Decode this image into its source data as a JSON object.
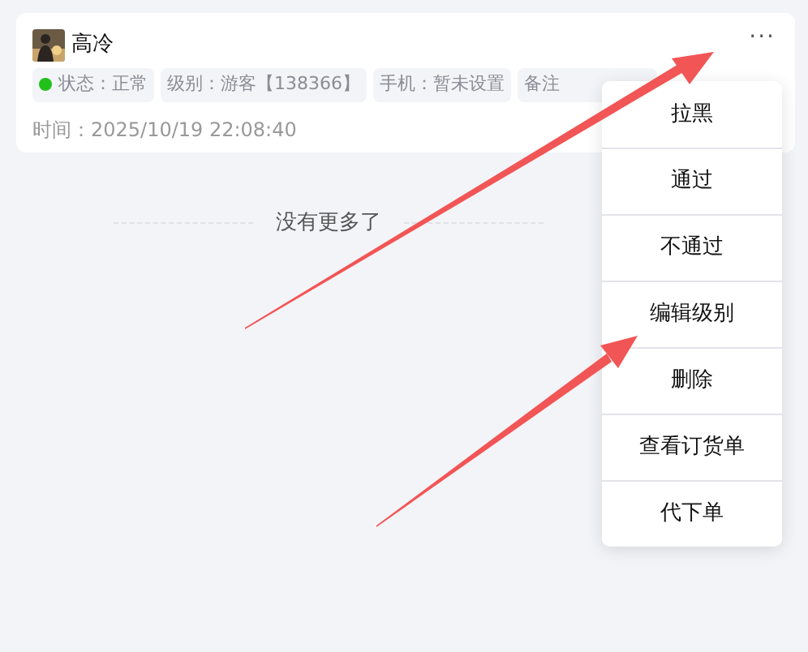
{
  "user": {
    "name": "高冷"
  },
  "tags": [
    {
      "kind": "status",
      "text": "状态：正常",
      "color": "#22c01a"
    },
    {
      "kind": "plain",
      "text": "级别：游客【138366】"
    },
    {
      "kind": "plain",
      "text": "手机：暂未设置"
    },
    {
      "kind": "plain",
      "text": "备注"
    }
  ],
  "more_button": {
    "label": "···"
  },
  "time": "时间：2025/10/19 22:08:40",
  "end_note": "没有更多了",
  "menu": [
    "拉黑",
    "通过",
    "不通过",
    "编辑级别",
    "删除",
    "查看订货单",
    "代下单"
  ]
}
